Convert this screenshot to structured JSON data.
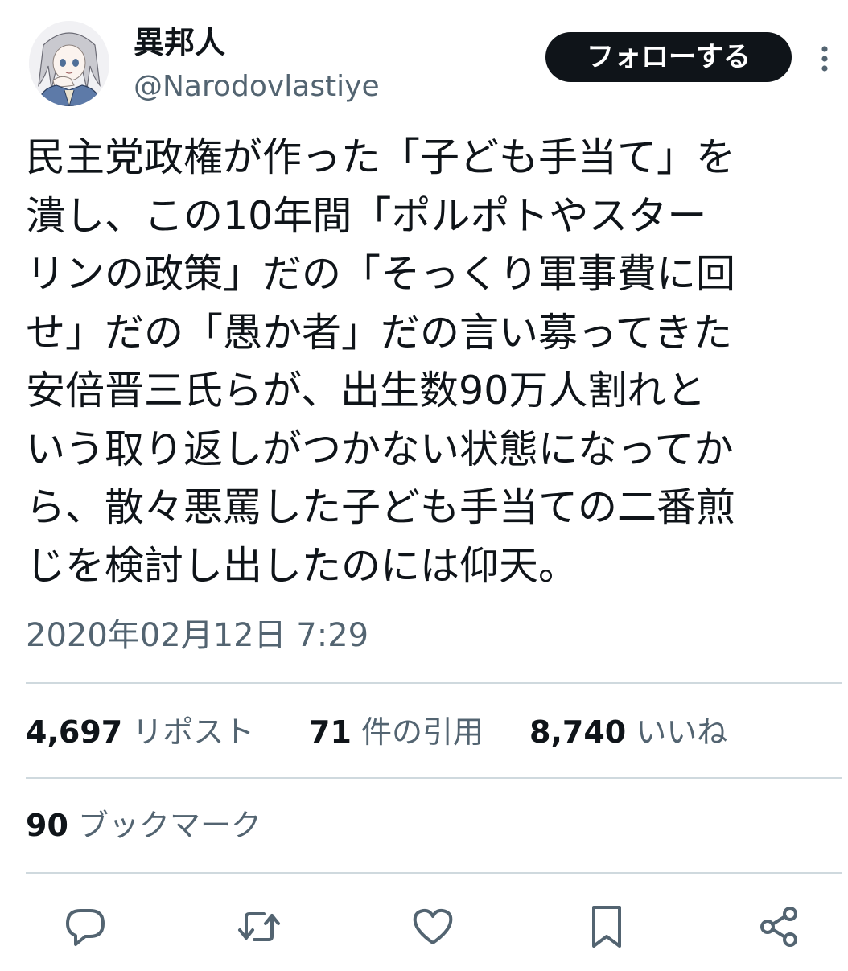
{
  "user": {
    "display_name": "異邦人",
    "handle": "@Narodovlastiye"
  },
  "follow_button": {
    "label": "フォローする"
  },
  "tweet": {
    "lines": [
      "民主党政権が作った「子ども手当て」を",
      "潰し、この10年間「ポルポトやスター",
      "リンの政策」だの「そっくり軍事費に回",
      "せ」だの「愚か者」だの言い募ってきた",
      "安倍晋三氏らが、出生数90万人割れと",
      "いう取り返しがつかない状態になってか",
      "ら、散々悪罵した子ども手当ての二番煎",
      "じを検討し出したのには仰天。"
    ],
    "timestamp": "2020年02月12日 7:29"
  },
  "stats": {
    "reposts": {
      "count": "4,697",
      "label": "リポスト"
    },
    "quotes": {
      "count": "71",
      "label": "件の引用"
    },
    "likes": {
      "count": "8,740",
      "label": "いいね"
    },
    "bookmarks": {
      "count": "90",
      "label": "ブックマーク"
    }
  },
  "icons": {
    "more": "more-vertical-icon",
    "reply": "reply-icon",
    "repost": "repost-icon",
    "like": "heart-icon",
    "bookmark": "bookmark-icon",
    "share": "share-icon"
  },
  "colors": {
    "text_primary": "#0f1419",
    "text_secondary": "#536471",
    "divider": "#cfd9de",
    "button_bg": "#0f1419",
    "button_text": "#ffffff"
  }
}
